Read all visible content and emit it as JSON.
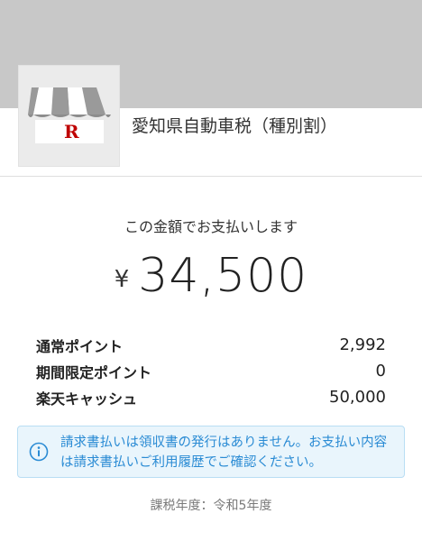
{
  "store": {
    "logo_mark": "R",
    "name": "愛知県自動車税（種別割）"
  },
  "payment": {
    "caption": "この金額でお支払いします",
    "currency_symbol": "¥",
    "amount": "34,500"
  },
  "points": [
    {
      "label": "通常ポイント",
      "value": "2,992"
    },
    {
      "label": "期間限定ポイント",
      "value": "0"
    },
    {
      "label": "楽天キャッシュ",
      "value": "50,000"
    }
  ],
  "notice": {
    "icon": "info-icon",
    "text": "請求書払いは領収書の発行はありません。お支払い内容は請求書払いご利用履歴でご確認ください。"
  },
  "footer": {
    "tax_year": "課税年度：令和5年度"
  },
  "colors": {
    "brand_red": "#bf0000",
    "info_blue": "#2a8bd4",
    "notice_bg": "#e9f5fc"
  }
}
